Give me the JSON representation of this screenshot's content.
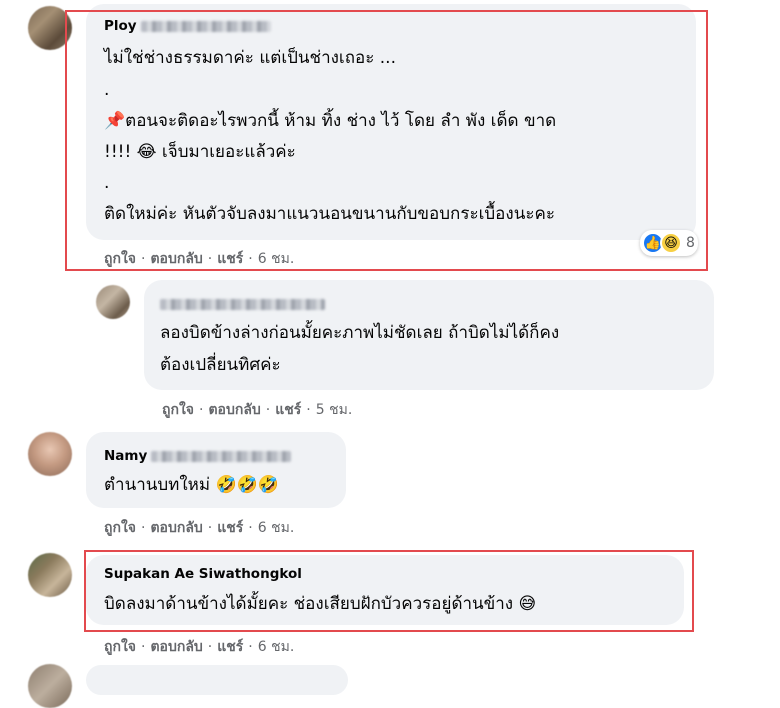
{
  "comments": [
    {
      "author_visible": "Ploy",
      "lines": [
        "ไม่ใช่ช่างธรรมดาค่ะ แต่เป็นช่างเถอะ ...",
        ".",
        "ตอนจะติดอะไรพวกนี้ ห้าม ทิ้ง ช่าง ไว้ โดย ลำ พัง เด็ด ขาด",
        "!!!! 😂 เจ็บมาเยอะแล้วค่ะ",
        ".",
        "ติดใหม่ค่ะ หันตัวจับลงมาแนวนอนขนานกับขอบกระเบื้องนะคะ"
      ],
      "line3_icon": "📌",
      "reaction_count": "8",
      "actions": {
        "like": "ถูกใจ",
        "reply": "ตอบกลับ",
        "share": "แชร์",
        "time": "6 ชม."
      }
    },
    {
      "author_visible": "",
      "lines": [
        "ลองบิดข้างล่างก่อนมั้ยคะภาพไม่ชัดเลย ถ้าบิดไม่ได้ก็คง",
        "ต้องเปลี่ยนทิศค่ะ"
      ],
      "actions": {
        "like": "ถูกใจ",
        "reply": "ตอบกลับ",
        "share": "แชร์",
        "time": "5 ชม."
      }
    },
    {
      "author_visible": "Namy",
      "lines": [
        "ตำนานบทใหม่ 🤣🤣🤣"
      ],
      "actions": {
        "like": "ถูกใจ",
        "reply": "ตอบกลับ",
        "share": "แชร์",
        "time": "6 ชม."
      }
    },
    {
      "author_visible": "Supakan Ae Siwathongkol",
      "lines": [
        "บิดลงมาด้านข้างได้มั้ยคะ ช่องเสียบฝักบัวควรอยู่ด้านข้าง 😅"
      ],
      "actions": {
        "like": "ถูกใจ",
        "reply": "ตอบกลับ",
        "share": "แชร์",
        "time": "6 ชม."
      }
    }
  ],
  "separator": "·",
  "colors": {
    "highlight": "#e34a4e",
    "bubble": "#f0f2f5",
    "meta": "#65676b",
    "like_blue": "#1877f2"
  }
}
